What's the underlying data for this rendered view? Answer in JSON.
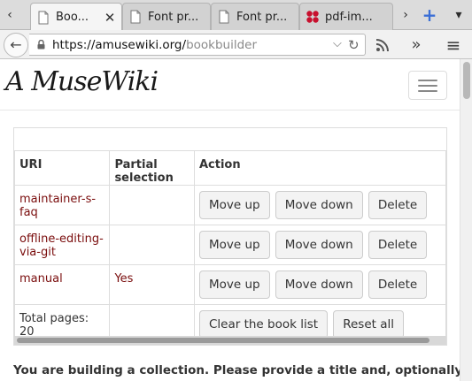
{
  "tabs": [
    {
      "title": "Boo...",
      "active": true,
      "closable": true
    },
    {
      "title": "Font pr...",
      "active": false
    },
    {
      "title": "Font pr...",
      "active": false
    },
    {
      "title": "pdf-im...",
      "active": false
    }
  ],
  "tabstrip": {
    "scroll_left": "‹",
    "scroll_right": "›",
    "new_tab": "+",
    "list_all": "▾"
  },
  "navbar": {
    "back": "←",
    "url_origin": "https://amusewiki.org/",
    "url_path": "bookbuilder",
    "url_dropdown": "⌵",
    "reload": "↻",
    "rss": "rss-icon",
    "overflow": "»",
    "menu": "≡"
  },
  "site": {
    "logo_text": "A MuseWiki"
  },
  "table": {
    "headers": {
      "uri": "URI",
      "partial": "Partial selection",
      "action": "Action"
    },
    "rows": [
      {
        "uri": "maintainer-s-faq",
        "partial": ""
      },
      {
        "uri": "offline-editing-via-git",
        "partial": ""
      },
      {
        "uri": "manual",
        "partial": "Yes"
      }
    ],
    "buttons": {
      "move_up": "Move up",
      "move_down": "Move down",
      "delete": "Delete"
    },
    "footer": {
      "total_pages": "Total pages: 20",
      "clear": "Clear the book list",
      "reset": "Reset all"
    }
  },
  "notice": "You are building a collection. Please provide a title and, optionally, any other",
  "colors": {
    "link": "#7a0d0d",
    "text": "#333333",
    "border": "#dddddd"
  }
}
